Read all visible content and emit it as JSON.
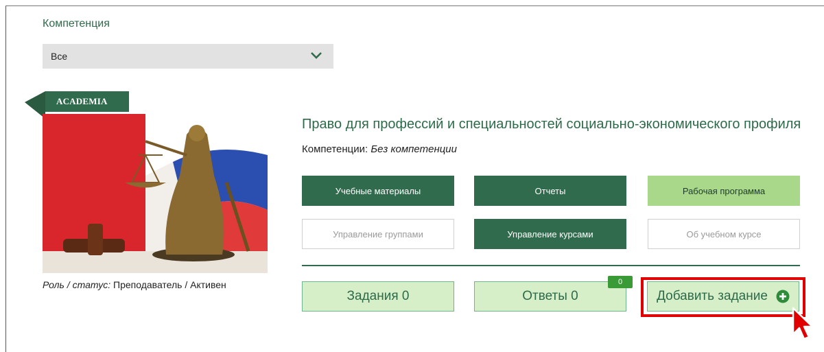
{
  "filter": {
    "label": "Компетенция",
    "selected": "Все"
  },
  "badge_ribbon": "ACADEMIA",
  "course": {
    "title": "Право для профессий и специальностей социально-экономического профиля",
    "competence_label": "Компетенции:",
    "competence_value": "Без компетенции",
    "role_label": "Роль / статус:",
    "role_value": "Преподаватель / Активен"
  },
  "buttons": {
    "study_materials": "Учебные материалы",
    "reports": "Отчеты",
    "work_program": "Рабочая программа",
    "manage_groups": "Управление группами",
    "manage_courses": "Управление курсами",
    "about_course": "Об учебном курсе",
    "tasks": "Задания 0",
    "answers": "Ответы 0",
    "answers_badge": "0",
    "add_task": "Добавить задание"
  },
  "colors": {
    "primary_green": "#2f6b4c",
    "light_green": "#a9d88a",
    "pale_green": "#d6efc8",
    "highlight_red": "#e00000",
    "badge_green": "#3a9a36"
  },
  "icons": [
    "chevron-down-icon",
    "plus-circle-icon",
    "mouse-cursor-icon"
  ]
}
